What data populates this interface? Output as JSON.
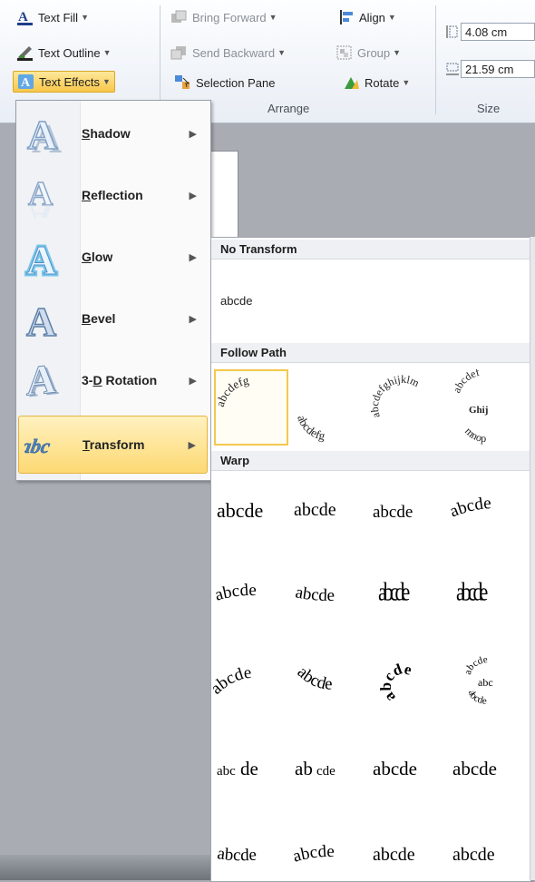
{
  "ribbon": {
    "text_fill": "Text Fill",
    "text_outline": "Text Outline",
    "text_effects": "Text Effects",
    "bring_forward": "Bring Forward",
    "send_backward": "Send Backward",
    "selection_pane": "Selection Pane",
    "align": "Align",
    "group": "Group",
    "rotate": "Rotate",
    "arrange_label": "Arrange",
    "size_label": "Size",
    "height_value": "4.08 cm",
    "width_value": "21.59 cm"
  },
  "effects_menu": {
    "items": [
      {
        "label": "Shadow",
        "accel": "S"
      },
      {
        "label": "Reflection",
        "accel": "R"
      },
      {
        "label": "Glow",
        "accel": "G"
      },
      {
        "label": "Bevel",
        "accel": "B"
      },
      {
        "label": "3-D Rotation",
        "accel": "D"
      },
      {
        "label": "Transform",
        "accel": "T"
      }
    ]
  },
  "transform_gallery": {
    "no_transform_header": "No Transform",
    "no_transform_sample": "abcde",
    "follow_path_header": "Follow Path",
    "warp_header": "Warp",
    "follow_path": [
      "abcdefg",
      "abcdefg",
      "abcdefghijklm",
      "abcdef Ghij mnop"
    ],
    "warp_rows": [
      [
        "abcde",
        "abcde",
        "abcde",
        "abcde"
      ],
      [
        "abcde",
        "abcde",
        "abcde",
        "abcde"
      ],
      [
        "abcde",
        "abcde",
        "abcde",
        "abcde"
      ],
      [
        "abcde",
        "abcde",
        "abcde",
        "abcde"
      ],
      [
        "abcde",
        "abcde",
        "abcde",
        "abcde"
      ]
    ]
  }
}
